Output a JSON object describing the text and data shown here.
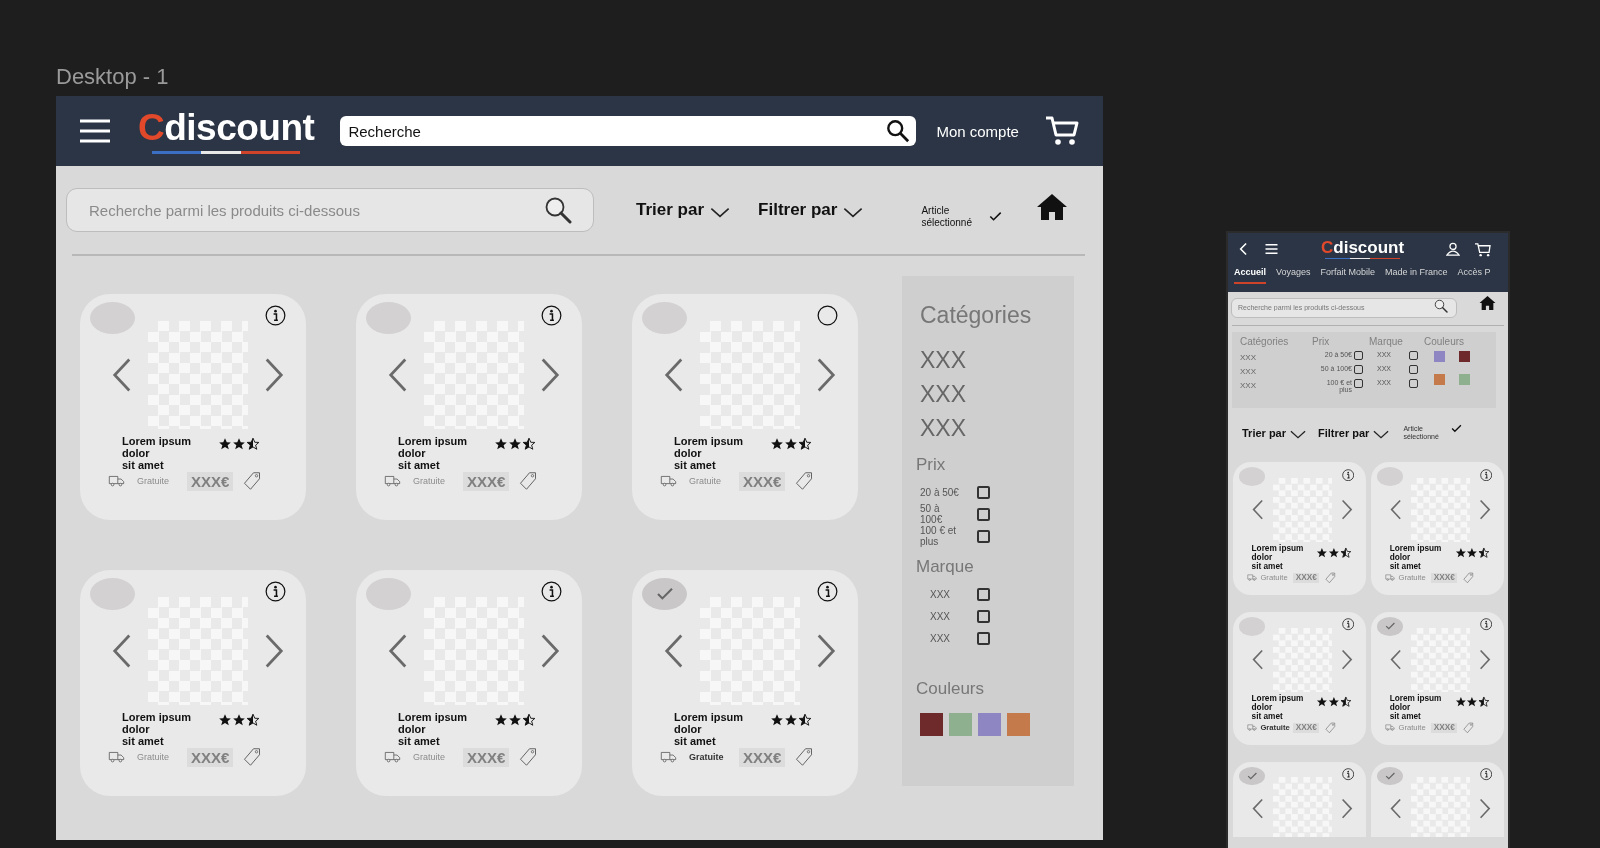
{
  "desktop": {
    "frame_label": "Desktop - 1",
    "header": {
      "logo": "Cdiscount",
      "search_placeholder": "Recherche",
      "account": "Mon compte"
    },
    "toolbar": {
      "search_placeholder": "Recherche parmi les produits ci-dessous",
      "sort": "Trier par",
      "filter": "Filtrer par",
      "selected_label": "Article sélectionné"
    },
    "products": [
      {
        "kind": "info",
        "name": "Lorem ipsum\ndolor\nsit amet",
        "stars": 2.5,
        "price": "XXX€",
        "delivery": "Gratuite",
        "delivery_highlighted": false,
        "selected": false
      },
      {
        "kind": "info",
        "name": "Lorem ipsum\ndolor\nsit amet",
        "stars": 2.5,
        "price": "XXX€",
        "delivery": "Gratuite",
        "delivery_highlighted": false,
        "selected": false
      },
      {
        "kind": "circle",
        "name": "Lorem ipsum\ndolor\nsit amet",
        "stars": 2.5,
        "price": "XXX€",
        "delivery": "Gratuite",
        "delivery_highlighted": false,
        "selected": false
      },
      {
        "kind": "info",
        "name": "Lorem ipsum\ndolor\nsit amet",
        "stars": 2.5,
        "price": "XXX€",
        "delivery": "Gratuite",
        "delivery_highlighted": false,
        "selected": false
      },
      {
        "kind": "info",
        "name": "Lorem ipsum\ndolor\nsit amet",
        "stars": 2.5,
        "price": "XXX€",
        "delivery": "Gratuite",
        "delivery_highlighted": false,
        "selected": false
      },
      {
        "kind": "info",
        "name": "Lorem ipsum\ndolor\nsit amet",
        "stars": 2.5,
        "price": "XXX€",
        "delivery": "Gratuite",
        "delivery_highlighted": true,
        "selected": true
      }
    ],
    "filters": {
      "categories": {
        "title": "Catégories",
        "items": [
          "XXX",
          "XXX",
          "XXX"
        ]
      },
      "price": {
        "title": "Prix",
        "options": [
          {
            "label": "20 à 50€",
            "checked": false
          },
          {
            "label": "50 à 100€",
            "checked": false
          },
          {
            "label": "100 € et plus",
            "checked": false
          }
        ]
      },
      "brand": {
        "title": "Marque",
        "options": [
          {
            "label": "XXX",
            "checked": false
          },
          {
            "label": "XXX",
            "checked": false
          },
          {
            "label": "XXX",
            "checked": false
          }
        ]
      },
      "colors": {
        "title": "Couleurs",
        "swatches": [
          {
            "color": "#6e2a2a"
          },
          {
            "color": "#8fb08f"
          },
          {
            "color": "#8e86c2"
          },
          {
            "color": "#c47a4a"
          }
        ]
      }
    }
  },
  "mobile": {
    "logo": "Cdiscount",
    "tabs": [
      {
        "label": "Accueil",
        "selected": true
      },
      {
        "label": "Voyages",
        "selected": false
      },
      {
        "label": "Forfait Mobile",
        "selected": false
      },
      {
        "label": "Made in France",
        "selected": false
      },
      {
        "label": "Accès P",
        "selected": false
      }
    ],
    "search_placeholder": "Recherche parmi les produits ci-dessous",
    "filters": {
      "categories": {
        "title": "Catégories",
        "items": [
          "XXX",
          "XXX",
          "XXX"
        ]
      },
      "price": {
        "title": "Prix",
        "options": [
          {
            "label": "20 à 50€",
            "checked": false
          },
          {
            "label": "50 à 100€",
            "checked": false
          },
          {
            "label": "100 € et plus",
            "checked": false
          }
        ]
      },
      "brand": {
        "title": "Marque",
        "options": [
          {
            "label": "XXX",
            "checked": false
          },
          {
            "label": "XXX",
            "checked": false
          },
          {
            "label": "XXX",
            "checked": false
          }
        ]
      },
      "colors": {
        "title": "Couleurs",
        "swatches": [
          {
            "color": "#8e86c2"
          },
          {
            "color": "#6e2a2a"
          },
          {
            "color": "#c47a4a"
          },
          {
            "color": "#8fb08f"
          }
        ]
      }
    },
    "sort": "Trier par",
    "filter": "Filtrer par",
    "selected_label": "Article sélectionné",
    "products": [
      {
        "kind": "info",
        "name": "Lorem ipsum\ndolor\nsit amet",
        "stars": 2.5,
        "price": "XXX€",
        "delivery": "Gratuite",
        "delivery_highlighted": false,
        "selected": false
      },
      {
        "kind": "info",
        "name": "Lorem ipsum\ndolor\nsit amet",
        "stars": 2.5,
        "price": "XXX€",
        "delivery": "Gratuite",
        "delivery_highlighted": false,
        "selected": false
      },
      {
        "kind": "info",
        "name": "Lorem ipsum\ndolor\nsit amet",
        "stars": 2.5,
        "price": "XXX€",
        "delivery": "Gratuite",
        "delivery_highlighted": true,
        "selected": false
      },
      {
        "kind": "info",
        "name": "Lorem ipsum\ndolor\nsit amet",
        "stars": 2.5,
        "price": "XXX€",
        "delivery": "Gratuite",
        "delivery_highlighted": false,
        "selected": true
      },
      {
        "kind": "info",
        "selected": true
      },
      {
        "kind": "info",
        "selected": true
      }
    ]
  }
}
